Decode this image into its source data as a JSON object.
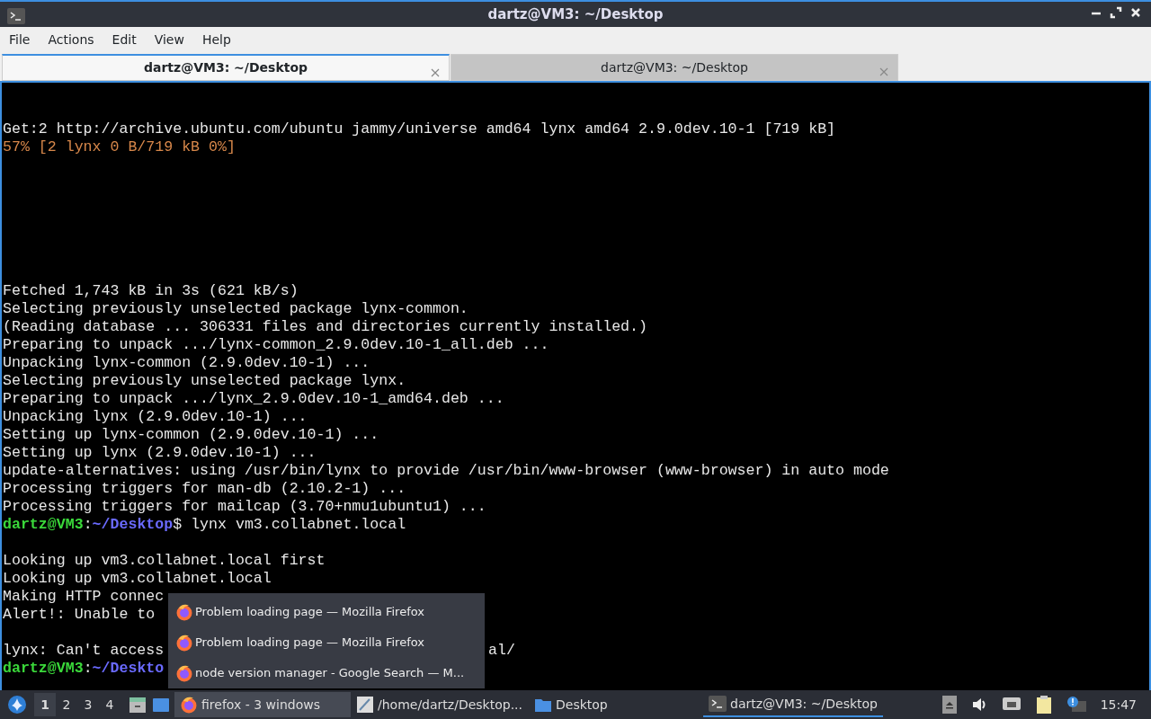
{
  "window": {
    "title": "dartz@VM3: ~/Desktop"
  },
  "menu": [
    "File",
    "Actions",
    "Edit",
    "View",
    "Help"
  ],
  "tabs": [
    {
      "label": "dartz@VM3: ~/Desktop",
      "selected": true
    },
    {
      "label": "dartz@VM3: ~/Desktop",
      "selected": false
    }
  ],
  "terminal": {
    "lines": [
      {
        "kind": "blank"
      },
      {
        "kind": "blank"
      },
      {
        "kind": "text",
        "segments": [
          {
            "kind": "plain",
            "text": "Get:2 http://archive.ubuntu.com/ubuntu jammy/universe amd64 lynx amd64 2.9.0dev.10-1 [719 kB]"
          }
        ]
      },
      {
        "kind": "text",
        "segments": [
          {
            "kind": "progress",
            "text": "57% [2 lynx 0 B/719 kB 0%]"
          }
        ]
      },
      {
        "kind": "blank"
      },
      {
        "kind": "blank"
      },
      {
        "kind": "blank"
      },
      {
        "kind": "blank"
      },
      {
        "kind": "blank"
      },
      {
        "kind": "blank"
      },
      {
        "kind": "blank"
      },
      {
        "kind": "text",
        "segments": [
          {
            "kind": "plain",
            "text": "Fetched 1,743 kB in 3s (621 kB/s)"
          }
        ]
      },
      {
        "kind": "text",
        "segments": [
          {
            "kind": "plain",
            "text": "Selecting previously unselected package lynx-common."
          }
        ]
      },
      {
        "kind": "text",
        "segments": [
          {
            "kind": "plain",
            "text": "(Reading database ... 306331 files and directories currently installed.)"
          }
        ]
      },
      {
        "kind": "text",
        "segments": [
          {
            "kind": "plain",
            "text": "Preparing to unpack .../lynx-common_2.9.0dev.10-1_all.deb ..."
          }
        ]
      },
      {
        "kind": "text",
        "segments": [
          {
            "kind": "plain",
            "text": "Unpacking lynx-common (2.9.0dev.10-1) ..."
          }
        ]
      },
      {
        "kind": "text",
        "segments": [
          {
            "kind": "plain",
            "text": "Selecting previously unselected package lynx."
          }
        ]
      },
      {
        "kind": "text",
        "segments": [
          {
            "kind": "plain",
            "text": "Preparing to unpack .../lynx_2.9.0dev.10-1_amd64.deb ..."
          }
        ]
      },
      {
        "kind": "text",
        "segments": [
          {
            "kind": "plain",
            "text": "Unpacking lynx (2.9.0dev.10-1) ..."
          }
        ]
      },
      {
        "kind": "text",
        "segments": [
          {
            "kind": "plain",
            "text": "Setting up lynx-common (2.9.0dev.10-1) ..."
          }
        ]
      },
      {
        "kind": "text",
        "segments": [
          {
            "kind": "plain",
            "text": "Setting up lynx (2.9.0dev.10-1) ..."
          }
        ]
      },
      {
        "kind": "text",
        "segments": [
          {
            "kind": "plain",
            "text": "update-alternatives: using /usr/bin/lynx to provide /usr/bin/www-browser (www-browser) in auto mode"
          }
        ]
      },
      {
        "kind": "text",
        "segments": [
          {
            "kind": "plain",
            "text": "Processing triggers for man-db (2.10.2-1) ..."
          }
        ]
      },
      {
        "kind": "text",
        "segments": [
          {
            "kind": "plain",
            "text": "Processing triggers for mailcap (3.70+nmu1ubuntu1) ..."
          }
        ]
      },
      {
        "kind": "text",
        "segments": [
          {
            "kind": "user",
            "text": "dartz@VM3"
          },
          {
            "kind": "plain",
            "text": ":"
          },
          {
            "kind": "path",
            "text": "~/Desktop"
          },
          {
            "kind": "plain",
            "text": "$ lynx vm3.collabnet.local"
          }
        ]
      },
      {
        "kind": "blank"
      },
      {
        "kind": "text",
        "segments": [
          {
            "kind": "plain",
            "text": "Looking up vm3.collabnet.local first"
          }
        ]
      },
      {
        "kind": "text",
        "segments": [
          {
            "kind": "plain",
            "text": "Looking up vm3.collabnet.local"
          }
        ]
      },
      {
        "kind": "text",
        "segments": [
          {
            "kind": "plain",
            "text": "Making HTTP connec"
          }
        ]
      },
      {
        "kind": "text",
        "segments": [
          {
            "kind": "plain",
            "text": "Alert!: Unable to"
          }
        ]
      },
      {
        "kind": "blank"
      },
      {
        "kind": "text",
        "segments": [
          {
            "kind": "plain",
            "text": "lynx: Can't access"
          },
          {
            "kind": "tail",
            "text": "al/"
          }
        ]
      },
      {
        "kind": "text",
        "segments": [
          {
            "kind": "user",
            "text": "dartz@VM3"
          },
          {
            "kind": "plain",
            "text": ":"
          },
          {
            "kind": "path",
            "text": "~/Deskto"
          }
        ]
      }
    ]
  },
  "popup": {
    "items": [
      "Problem loading page — Mozilla Firefox",
      "Problem loading page — Mozilla Firefox",
      "node version manager - Google Search — M..."
    ]
  },
  "taskbar": {
    "desktops": [
      {
        "label": "1",
        "selected": true
      },
      {
        "label": "2",
        "selected": false
      },
      {
        "label": "3",
        "selected": false
      },
      {
        "label": "4",
        "selected": false
      }
    ],
    "tasks": [
      {
        "kind": "firefox",
        "label": "firefox - 3 windows",
        "selected": true,
        "active": false
      },
      {
        "kind": "editor",
        "label": "/home/dartz/Desktop...",
        "selected": false,
        "active": false
      },
      {
        "kind": "folder",
        "label": "Desktop",
        "selected": false,
        "active": false
      },
      {
        "kind": "terminal",
        "label": "dartz@VM3: ~/Desktop",
        "selected": false,
        "active": true
      }
    ],
    "clock": "15:47"
  }
}
